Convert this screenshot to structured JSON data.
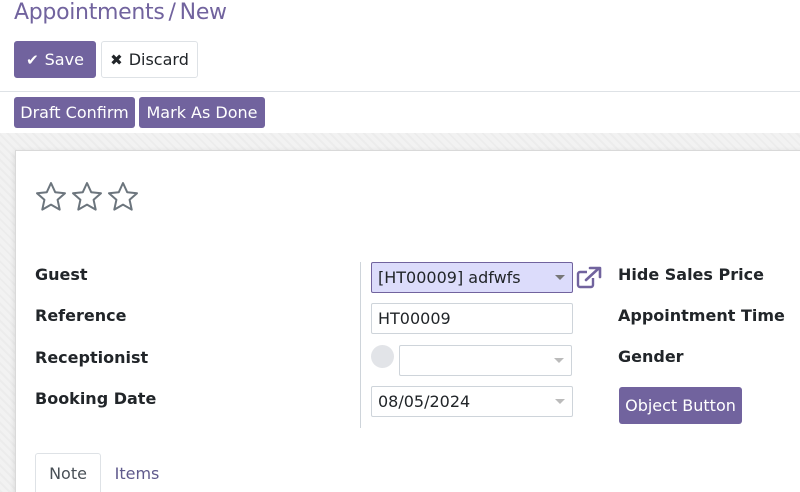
{
  "breadcrumb": {
    "parent": "Appointments",
    "separator": "/",
    "current": "New"
  },
  "toolbar": {
    "save_label": "Save",
    "discard_label": "Discard"
  },
  "statusbar": {
    "draft_confirm_label": "Draft Confirm",
    "mark_done_label": "Mark As Done"
  },
  "priority": {
    "stars_filled": 0,
    "stars_total": 3
  },
  "form": {
    "left_labels": {
      "guest": "Guest",
      "reference": "Reference",
      "receptionist": "Receptionist",
      "booking_date": "Booking Date"
    },
    "guest_value": "[HT00009] adfwfs",
    "reference_value": "HT00009",
    "receptionist_value": "",
    "booking_date_value": "08/05/2024",
    "right_labels": {
      "hide_sales_price": "Hide Sales Price",
      "appointment_time": "Appointment Time",
      "gender": "Gender"
    },
    "object_button_label": "Object Button"
  },
  "tabs": [
    {
      "label": "Note",
      "active": true
    },
    {
      "label": "Items",
      "active": false
    }
  ],
  "colors": {
    "brand": "#71639e",
    "selected_field_bg": "#dcdcfb"
  }
}
